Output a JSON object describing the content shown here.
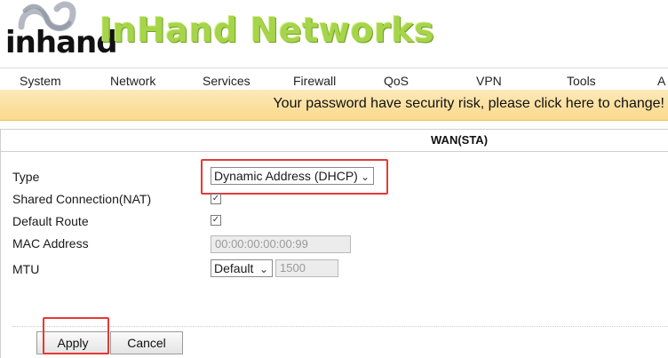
{
  "brand": {
    "logo_word": "inhand",
    "name": "InHand Networks"
  },
  "menu": [
    "System",
    "Network",
    "Services",
    "Firewall",
    "QoS",
    "VPN",
    "Tools",
    "A"
  ],
  "warning": "Your password have security risk, please click here to change!",
  "panel": {
    "title": "WAN(STA)"
  },
  "form": {
    "type_label": "Type",
    "type_value": "Dynamic Address (DHCP)",
    "nat_label": "Shared Connection(NAT)",
    "nat_checked": true,
    "default_route_label": "Default Route",
    "default_route_checked": true,
    "mac_label": "MAC Address",
    "mac_value": "00:00:00:00:00:99",
    "mtu_label": "MTU",
    "mtu_mode": "Default",
    "mtu_value": "1500"
  },
  "buttons": {
    "apply": "Apply",
    "cancel": "Cancel"
  },
  "colors": {
    "brand_green": "#a6d44a",
    "warn_bg": "#fbe3a6",
    "highlight_red": "#e53935"
  },
  "icons": {
    "chevron": "chevron-down-icon",
    "check": "checkmark-icon"
  }
}
